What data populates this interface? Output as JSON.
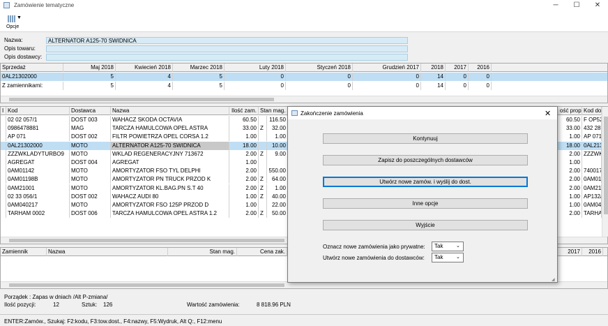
{
  "window": {
    "title": "Zamówienie tematyczne"
  },
  "toolbar": {
    "opcje_label": "Opcje"
  },
  "fields": {
    "nazwa_label": "Nazwa:",
    "nazwa_value": "ALTERNATOR A125-70 SWIDNICA",
    "opis_towaru_label": "Opis towaru:",
    "opis_dostawcy_label": "Opis dostawcy:"
  },
  "sales": {
    "headers": [
      "Sprzedaż",
      "Maj 2018",
      "Kwiecień 2018",
      "Marzec 2018",
      "Luty 2018",
      "Styczeń 2018",
      "Grudzień 2017",
      "2018",
      "2017",
      "2016"
    ],
    "rows": [
      [
        "0AL21302000",
        "5",
        "4",
        "5",
        "0",
        "0",
        "0",
        "14",
        "0",
        "0"
      ],
      [
        "Z zamiennikami:",
        "5",
        "4",
        "5",
        "0",
        "0",
        "0",
        "14",
        "0",
        "0"
      ]
    ]
  },
  "items": {
    "headers": [
      "I",
      "Kod",
      "Dostawca",
      "Nazwa",
      "Ilość zam.",
      "Stan mag.",
      "ość prop.",
      "Kod dos"
    ],
    "rows": [
      [
        "02 02 057/1",
        "DOST 003",
        "WAHACZ SKODA OCTAVIA",
        "60.50",
        "",
        "116.50",
        "60.50",
        "F OP52"
      ],
      [
        "0986478881",
        "MAG",
        "TARCZA HAMULCOWA OPEL ASTRA",
        "33.00",
        "Z",
        "32.00",
        "33.00",
        "432 287"
      ],
      [
        "AP 071",
        "DOST 002",
        "FILTR POWIETRZA OPEL CORSA 1.2",
        "1.00",
        "",
        "1.00",
        "1.00",
        "AP 071"
      ],
      [
        "0AL21302000",
        "MOTO",
        "ALTERNATOR A125-70 SWIDNICA",
        "18.00",
        "",
        "10.00",
        "18.00",
        "0AL213"
      ],
      [
        "ZZZWKLADYTURBO9",
        "MOTO",
        "WKLAD REGENERACYJNY 713672",
        "2.00",
        "Z",
        "9.00",
        "2.00",
        "ZZZWKL"
      ],
      [
        "AGREGAT",
        "DOST 004",
        "AGREGAT",
        "1.00",
        "",
        "",
        "1.00",
        ""
      ],
      [
        "0AM01142",
        "MOTO",
        "AMORTYZATOR FSO TYL DELPHI",
        "2.00",
        "",
        "550.00",
        "2.00",
        "740017"
      ],
      [
        "0AM01198B",
        "MOTO",
        "AMORTYZATOR PN TRUCK PRZOD K",
        "2.00",
        "Z",
        "64.00",
        "2.00",
        "0AM011"
      ],
      [
        "0AM21001",
        "MOTO",
        "AMORTYZATOR KL.BAG.PN S.T 40",
        "2.00",
        "Z",
        "1.00",
        "2.00",
        "0AM210"
      ],
      [
        "02 33 056/1",
        "DOST 002",
        "WAHACZ AUDI 80",
        "1.00",
        "Z",
        "40.00",
        "1.00",
        "AP132/"
      ],
      [
        "0AM040217",
        "MOTO",
        "AMORTYZATOR FSO 125P PRZOD D",
        "1.00",
        "",
        "22.00",
        "1.00",
        "0AM040"
      ],
      [
        "TARHAM 0002",
        "DOST 006",
        "TARCZA HAMULCOWA OPEL ASTRA 1.2",
        "2.00",
        "Z",
        "50.00",
        "2.00",
        "TARHAM"
      ]
    ]
  },
  "subs": {
    "headers": [
      "Zamiennik",
      "Nazwa",
      "Stan mag.",
      "Cena zak.",
      "2017",
      "2016"
    ]
  },
  "dialog": {
    "title": "Zakończenie zamówienia",
    "buttons": [
      "Kontynuuj",
      "Zapisz do poszczególnych dostawców",
      "Utwórz nowe zamów. i wyślij do dost.",
      "Inne opcje",
      "Wyjście"
    ],
    "private_label": "Oznacz nowe zamówienia jako prywatne:",
    "private_value": "Tak",
    "suppliers_label": "Utwórz nowe zamówienia do dostawców:",
    "suppliers_value": "Tak"
  },
  "summary": {
    "order_text": "Porządek : Zapas w dniach /Alt P-zmiana/",
    "positions_label": "Ilość pozycji:",
    "positions_value": "12",
    "pieces_label": "Sztuk:",
    "pieces_value": "126",
    "value_label": "Wartość zamówienia:",
    "value_value": "8 818.96 PLN"
  },
  "statusbar": {
    "text": "ENTER:Zamów., Szukaj: F2:kodu, F3:tow.dost., F4:nazwy, F5:Wydruk, Alt Q:, F12:menu"
  }
}
